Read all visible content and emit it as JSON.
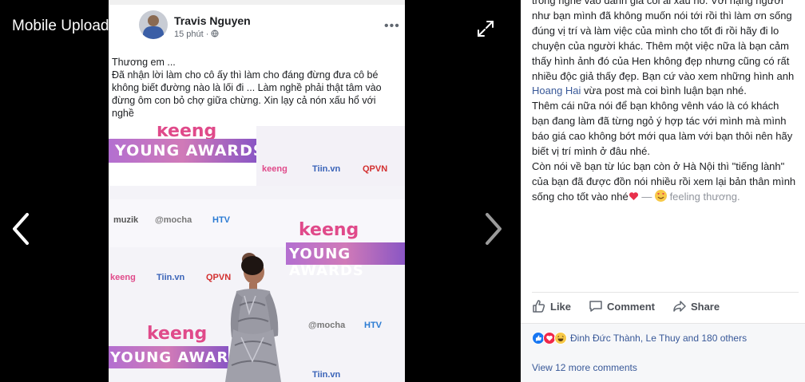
{
  "viewer": {
    "album_title": "Mobile Uploads"
  },
  "phone_post": {
    "author": "Travis Nguyen",
    "time": "15 phút · ",
    "text": "Thương em ...\nĐã nhận lời làm cho cô ấy thì làm cho đáng đừng đưa cô bé không biết đường nào là lối đi ... Làm nghề phải thật tâm vào đừng ôm con bỏ chợ giữa chừng.  Xin lạy cả nón xấu hổ với nghề"
  },
  "photo": {
    "boards": [
      {
        "keeng": "keeng",
        "title": "YOUNG AWARDS"
      },
      {
        "keeng": "keeng",
        "title": "YOUNG AWARDS"
      },
      {
        "keeng": "keeng",
        "title": "YOUNG AWARDS"
      }
    ],
    "logos": [
      "keeng",
      "Tiin.vn",
      "QPVN",
      "muzik",
      "@mocha",
      "HTV",
      "keeng",
      "Tiin.vn",
      "QPVN",
      "@mocha",
      "HTV",
      "Tiin.vn"
    ]
  },
  "caption": {
    "p1_before": "trong nghề vào đánh giá coi ai xấu hổ. Với hạng người như bạn mình đã không muốn nói tới rồi thì làm ơn sống đúng vị trí và làm việc của mình cho tốt đi rồi hãy đi lo chuyện của người khác. Thêm một việc nữa là bạn cảm thấy hình ảnh đó của Hen không đẹp nhưng cũng có rất nhiều độc giả thấy đẹp. Bạn cứ vào xem những hình anh ",
    "p1_link": "Hoang Hai",
    "p1_after": " vừa post mà coi bình luận bạn nhé.",
    "p2": "Thêm cái nữa nói để bạn không vênh váo là có khách bạn đang làm đã từng ngỏ ý hợp tác với mình mà mình báo giá cao không bớt mới qua làm với bạn thôi nên hãy biết vị trí mình ở đâu nhé.",
    "p3": "Còn nói về bạn từ lúc bạn còn ở Hà Nội thì \"tiếng lành\" của bạn đã được đồn nói nhiều rồi xem lại bản thân mình sống cho tốt vào nhé",
    "dash": " — ",
    "feeling": "feeling thương."
  },
  "actions": {
    "like": "Like",
    "comment": "Comment",
    "share": "Share"
  },
  "reactions": {
    "names": "Đinh Đức Thành, Le Thuy and 180 others"
  },
  "comments": {
    "view_more": "View 12 more comments"
  },
  "colors": {
    "link": "#385898",
    "like_blue": "#1877f2",
    "love_red": "#f0284a",
    "haha_yellow": "#f7c948"
  }
}
